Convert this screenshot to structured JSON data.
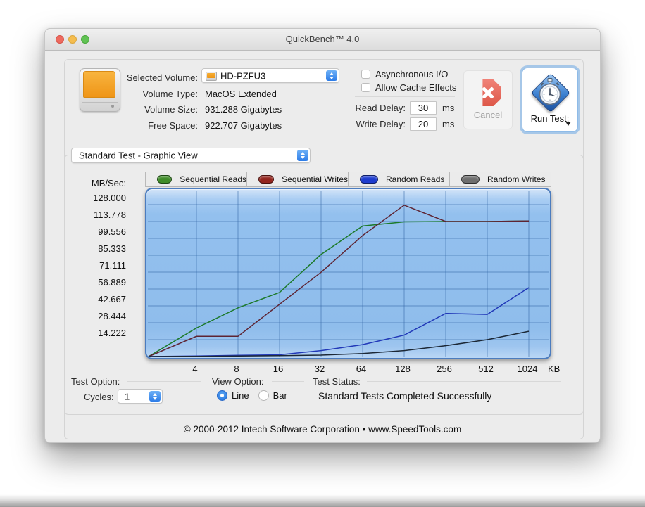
{
  "window": {
    "title": "QuickBench™ 4.0"
  },
  "volume": {
    "selected_volume_label": "Selected Volume:",
    "selected_volume_value": "HD-PZFU3",
    "rows": [
      {
        "label": "Volume Type:",
        "value": "MacOS Extended"
      },
      {
        "label": "Volume Size:",
        "value": "931.288 Gigabytes"
      },
      {
        "label": "Free Space:",
        "value": "922.707 Gigabytes"
      }
    ]
  },
  "io_options": {
    "async_io_label": "Asynchronous I/O",
    "async_io_checked": false,
    "cache_label": "Allow Cache Effects",
    "cache_checked": false,
    "read_delay_label": "Read Delay:",
    "read_delay_value": "30",
    "write_delay_label": "Write Delay:",
    "write_delay_value": "20",
    "unit_ms": "ms"
  },
  "actions": {
    "cancel_label": "Cancel",
    "run_test_label": "Run Test:"
  },
  "test_selector": {
    "value": "Standard Test - Graphic View"
  },
  "chart_data": {
    "type": "line",
    "y_axis_title": "MB/Sec:",
    "x_axis_unit": "KB",
    "categories": [
      "4",
      "8",
      "16",
      "32",
      "64",
      "128",
      "256",
      "512",
      "1024"
    ],
    "y_tick_labels": [
      "128.000",
      "113.778",
      "99.556",
      "85.333",
      "71.111",
      "56.889",
      "42.667",
      "28.444",
      "14.222"
    ],
    "y_tick_step": 14.222,
    "ylim": [
      0,
      142.22
    ],
    "grid": true,
    "legend_position": "top",
    "plot_bg": "#92bfee",
    "grid_color": "#2f62a2",
    "origin_value": 0,
    "series": [
      {
        "name": "Sequential Reads",
        "color": "#1c7a2a",
        "legend_fill": "#3f8c28",
        "legend_border": "#1d4713",
        "values": [
          24,
          41,
          54,
          86,
          110,
          113.5,
          113.8,
          113.8,
          114.2
        ]
      },
      {
        "name": "Sequential Writes",
        "color": "#5e2433",
        "legend_fill": "#93251e",
        "legend_border": "#49100c",
        "values": [
          17,
          17,
          44,
          71,
          102,
          127.5,
          113.8,
          113.8,
          114.2
        ]
      },
      {
        "name": "Random Reads",
        "color": "#2138b8",
        "legend_fill": "#1e3cce",
        "legend_border": "#101f66",
        "values": [
          0.5,
          1,
          1.5,
          5,
          10,
          18,
          36.3,
          35.5,
          58.1
        ]
      },
      {
        "name": "Random Writes",
        "color": "#1c2836",
        "legend_fill": "#6e6e6e",
        "legend_border": "#2e2e2e",
        "values": [
          0.2,
          0.4,
          0.7,
          1.2,
          2.5,
          5,
          9.1,
          14.2,
          21.3
        ]
      }
    ]
  },
  "bottom_controls": {
    "test_option_label": "Test Option:",
    "cycles_label": "Cycles:",
    "cycles_value": "1",
    "view_option_label": "View Option:",
    "view_options": [
      "Line",
      "Bar"
    ],
    "view_selected": "Line",
    "test_status_label": "Test Status:",
    "status_text": "Standard Tests Completed Successfully"
  },
  "footer": {
    "text": "© 2000-2012 Intech Software Corporation • www.SpeedTools.com"
  }
}
